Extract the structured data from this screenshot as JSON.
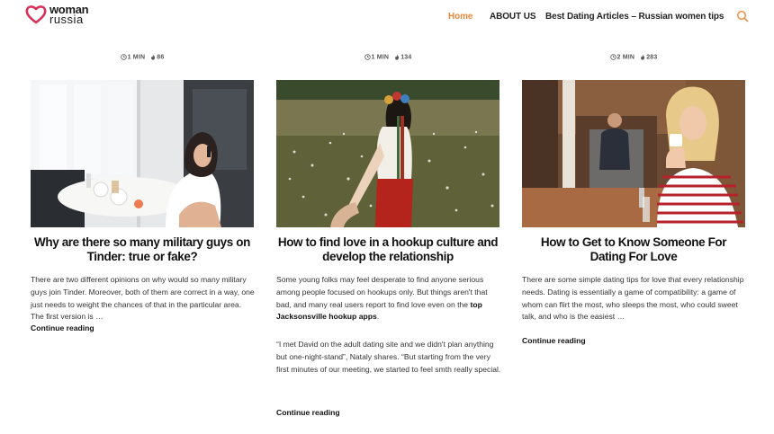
{
  "header": {
    "logo_line1": "woman",
    "logo_line2": "russia",
    "logo_color": "#d8315b",
    "nav": [
      {
        "label": "Home",
        "active": true
      },
      {
        "label": "ABOUT US",
        "active": false
      },
      {
        "label": "Best Dating Articles – Russian women tips",
        "active": false
      }
    ],
    "accent_color": "#e8883a",
    "search_icon": "search-icon"
  },
  "posts": [
    {
      "read_time": "1 MIN",
      "views": "86",
      "title": "Why are there so many military guys on Tinder: true or fake?",
      "excerpt": "There are two different opinions on why would so many military guys join Tinder. Moreover, both of them are correct in a way, one just needs to weight the chances of that in the particular area. The first version is …",
      "more": "Continue reading"
    },
    {
      "read_time": "1 MIN",
      "views": "134",
      "title": "How to find love in a hookup culture and develop the relationship",
      "excerpt_pre": "Some young folks may feel desperate to find anyone serious among people focused on hookups only. But things aren't that bad, and many real users report to find love even on the ",
      "excerpt_link": "top Jacksonsville hookup apps",
      "excerpt_post": ".",
      "quote": "“I met David on the adult dating site and we didn't plan anything but one-night-stand”, Nataly shares. “But starting from the very first minutes of our meeting, we started to feel smth really special.",
      "more": "Continue reading"
    },
    {
      "read_time": "2 MIN",
      "views": "283",
      "title": "How to Get to Know Someone For Dating For Love",
      "excerpt": "There are some simple dating tips for love that every relationship needs. Dating is essentially a game of compatibility: a game of whom can flirt the most, who sleeps the most, who could sweet talk, and who is the easiest …",
      "more": "Continue reading"
    }
  ]
}
